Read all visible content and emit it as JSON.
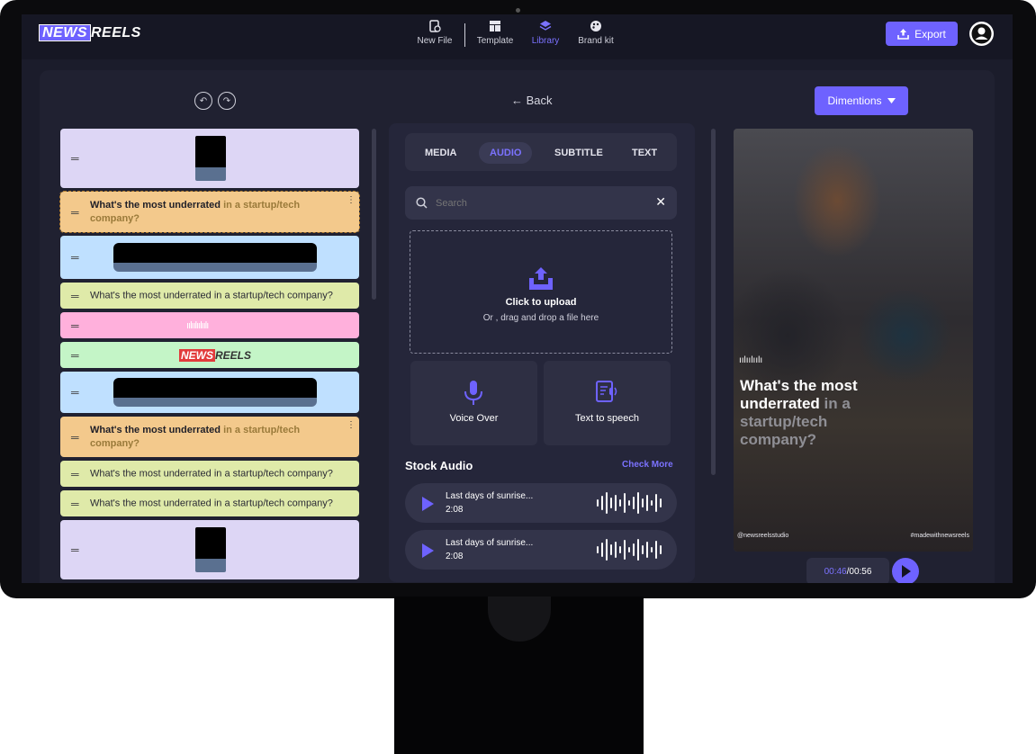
{
  "app": {
    "logo_news": "NEWS",
    "logo_reels": "REELS"
  },
  "nav": [
    {
      "label": "New File",
      "icon": "new-file-icon"
    },
    {
      "label": "Template",
      "icon": "template-icon"
    },
    {
      "label": "Library",
      "icon": "layers-icon",
      "active": true
    },
    {
      "label": "Brand kit",
      "icon": "palette-icon"
    }
  ],
  "header": {
    "export_label": "Export"
  },
  "toolbar": {
    "back_label": "Back",
    "dimensions_label": "Dimentions"
  },
  "cards": [
    {
      "type": "image",
      "color": "#ddd6f5"
    },
    {
      "type": "text-bold",
      "color": "#f3c98c",
      "bold": "What's the most underrated",
      "rest": " in a startup/tech company?"
    },
    {
      "type": "video",
      "color": "#bfe0ff"
    },
    {
      "type": "text",
      "color": "#dfeaa9",
      "text": "What's the most underrated in a startup/tech company?"
    },
    {
      "type": "audio",
      "color": "#ffb0dc"
    },
    {
      "type": "logo",
      "color": "#c4f5c7"
    },
    {
      "type": "video",
      "color": "#bfe0ff"
    },
    {
      "type": "text-bold",
      "color": "#f3c98c",
      "bold": "What's the most underrated",
      "rest": " in a startup/tech company?"
    },
    {
      "type": "text",
      "color": "#dfeaa9",
      "text": "What's the most underrated in a startup/tech company?"
    },
    {
      "type": "text",
      "color": "#dfeaa9",
      "text": "What's the most underrated in a startup/tech company?"
    },
    {
      "type": "image",
      "color": "#ddd6f5"
    }
  ],
  "tabs": [
    {
      "label": "MEDIA"
    },
    {
      "label": "AUDIO",
      "active": true
    },
    {
      "label": "SUBTITLE"
    },
    {
      "label": "TEXT"
    }
  ],
  "search": {
    "placeholder": "Search"
  },
  "upload": {
    "title": "Click to upload",
    "subtitle": "Or , drag and drop a file here"
  },
  "tools": {
    "voice_over": "Voice Over",
    "tts": "Text to speech"
  },
  "stock": {
    "title": "Stock Audio",
    "check_more": "Check More",
    "tracks": [
      {
        "name": "Last days of sunrise...",
        "duration": "2:08"
      },
      {
        "name": "Last days of sunrise...",
        "duration": "2:08"
      }
    ]
  },
  "preview": {
    "caption_bold": "What's the most underrated",
    "caption_rest": " in a startup/tech company?",
    "handle_left": "@newsreelsstudio",
    "handle_right": "#madewithnewsreels",
    "time_current": "00:46",
    "time_sep": " / ",
    "time_total": "00:56"
  },
  "colors": {
    "accent": "#6e62ff",
    "bg": "#1b1c2b",
    "panel": "#25263a"
  }
}
